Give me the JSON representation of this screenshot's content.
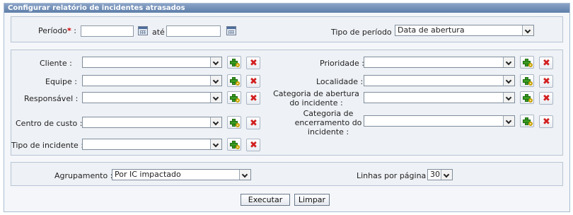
{
  "title": "Configurar relatório de incidentes atrasados",
  "period": {
    "label": "Período",
    "required_mark": "*",
    "colon": ":",
    "separator": "até",
    "start_value": "",
    "end_value": ""
  },
  "period_type": {
    "label": "Tipo de período :",
    "value": "Data de abertura"
  },
  "filters_left": [
    {
      "label": "Cliente :",
      "value": ""
    },
    {
      "label": "Equipe :",
      "value": ""
    },
    {
      "label": "Responsável :",
      "value": ""
    },
    {
      "label": "Centro de custo :",
      "value": ""
    },
    {
      "label": "Tipo de incidente :",
      "value": ""
    }
  ],
  "filters_right": [
    {
      "label": "Prioridade :",
      "value": ""
    },
    {
      "label": "Localidade :",
      "value": ""
    },
    {
      "label": "Categoria de abertura do incidente :",
      "value": ""
    },
    {
      "label": "Categoria de encerramento do incidente :",
      "value": ""
    }
  ],
  "grouping": {
    "label": "Agrupamento :",
    "value": "Por IC impactado"
  },
  "lines_per_page": {
    "label": "Linhas por página :",
    "value": "30"
  },
  "buttons": {
    "run": "Executar",
    "clear": "Limpar"
  },
  "icons": {
    "add": "add-icon",
    "remove": "remove-icon",
    "calendar": "calendar-icon"
  },
  "colors": {
    "title_bar": "#5e7ea9",
    "remove": "#d21f1f",
    "add": "#3a9b22"
  }
}
